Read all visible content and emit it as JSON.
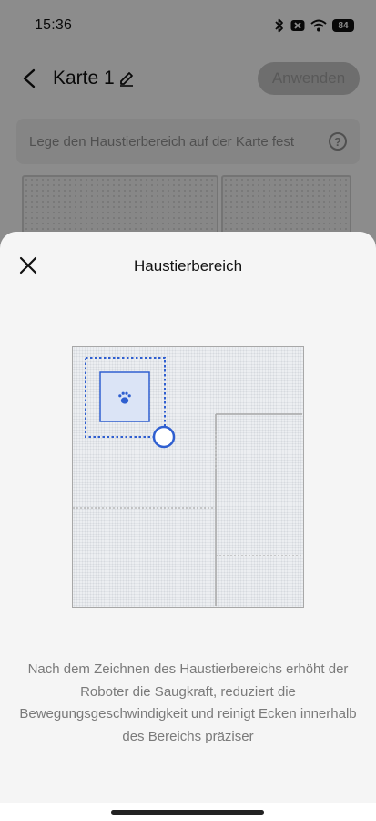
{
  "status_bar": {
    "time": "15:36",
    "battery": "84",
    "icons": [
      "bluetooth-icon",
      "mute-icon",
      "wifi-icon",
      "battery-icon"
    ]
  },
  "header": {
    "title": "Karte 1",
    "apply_label": "Anwenden"
  },
  "hint": {
    "text": "Lege den Haustierbereich auf der Karte fest",
    "help_symbol": "?"
  },
  "sheet": {
    "title": "Haustierbereich",
    "description": "Nach dem Zeichnen des Haustierbereichs erhöht der Roboter die Saugkraft, reduziert die Bewegungsgeschwindigkeit und reinigt Ecken innerhalb des Bereichs präziser"
  },
  "colors": {
    "accent": "#2f5fd0",
    "zone_fill": "#dbe4f6",
    "dim": "#8f8f8f",
    "sheet_bg": "#f5f5f5"
  }
}
